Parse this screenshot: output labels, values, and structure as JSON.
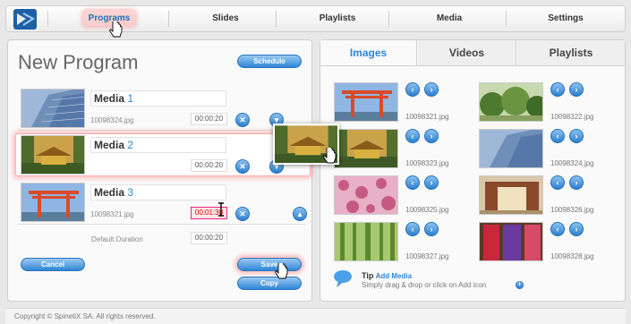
{
  "nav": {
    "items": [
      {
        "label": "Programs",
        "active": true
      },
      {
        "label": "Slides"
      },
      {
        "label": "Playlists"
      },
      {
        "label": "Media"
      },
      {
        "label": "Settings"
      }
    ]
  },
  "left": {
    "title": "New Program",
    "schedule_label": "Schedule",
    "rows": [
      {
        "name": "Media",
        "num": "1",
        "file": "10098324.jpg",
        "duration": "00:00:20"
      },
      {
        "name": "Media",
        "num": "2",
        "file": "",
        "duration": "00:00:20"
      },
      {
        "name": "Media",
        "num": "3",
        "file": "10098321.jpg",
        "duration": "00:01:30"
      }
    ],
    "default_duration_label": "Default Duration",
    "default_duration": "00:00:20",
    "cancel_label": "Cancel",
    "save_label": "Save",
    "copy_label": "Copy"
  },
  "right": {
    "tabs": [
      "Images",
      "Videos",
      "Playlists"
    ],
    "active_tab": "Images",
    "images": [
      {
        "file": "10098321.jpg",
        "kind": "torii"
      },
      {
        "file": "10098322.jpg",
        "kind": "garden"
      },
      {
        "file": "10098323.jpg",
        "kind": "temple"
      },
      {
        "file": "10098324.jpg",
        "kind": "building"
      },
      {
        "file": "10098325.jpg",
        "kind": "blossom"
      },
      {
        "file": "10098326.jpg",
        "kind": "hall"
      },
      {
        "file": "10098327.jpg",
        "kind": "bamboo"
      },
      {
        "file": "10098328.jpg",
        "kind": "banners"
      }
    ],
    "tip_label": "Tip",
    "tip_link": "Add Media",
    "tip_text": "Simply drag & drop or click on Add icon"
  },
  "footer": {
    "copyright": "Copyright © SpinetiX SA. All rights reserved."
  },
  "colors": {
    "accent": "#2e86d6",
    "highlight": "#ff8c8c"
  }
}
